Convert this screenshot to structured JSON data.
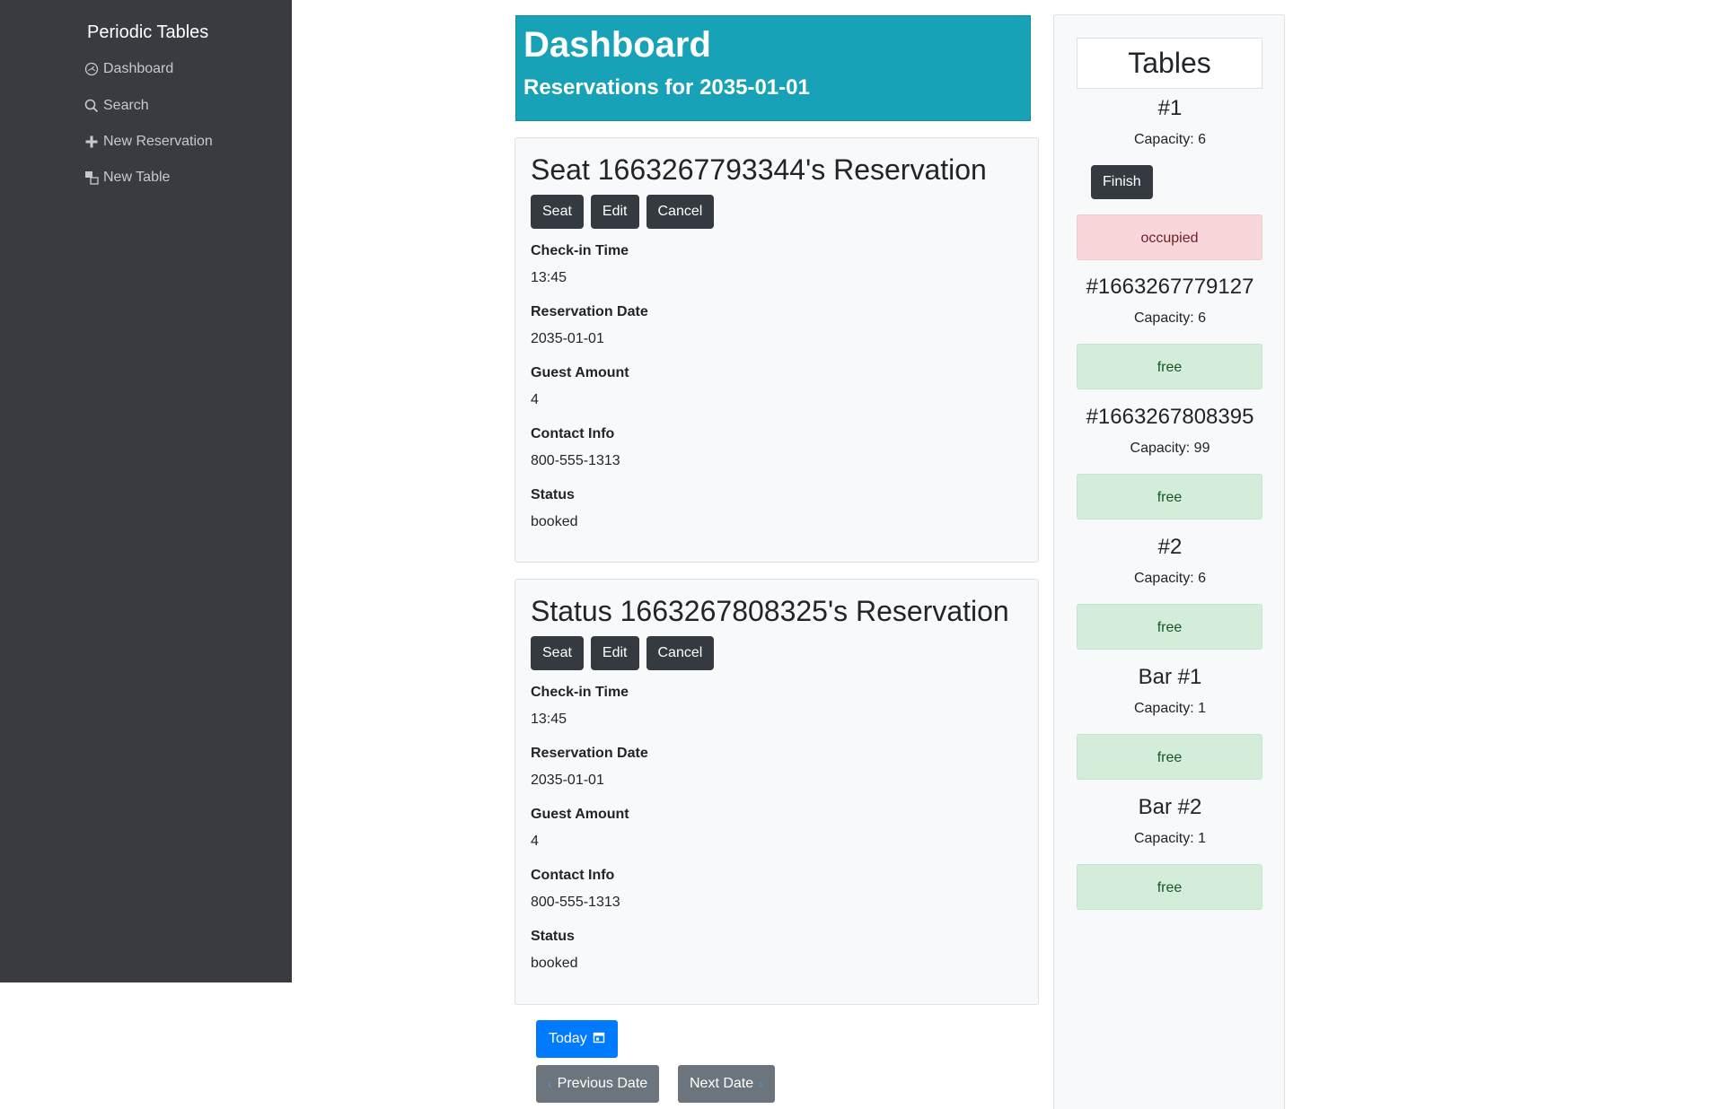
{
  "sidebar": {
    "brand": "Periodic Tables",
    "items": [
      {
        "label": "Dashboard",
        "icon": "dashboard-icon"
      },
      {
        "label": "Search",
        "icon": "search-icon"
      },
      {
        "label": "New Reservation",
        "icon": "plus-icon"
      },
      {
        "label": "New Table",
        "icon": "table-icon"
      }
    ]
  },
  "header": {
    "title": "Dashboard",
    "subtitle": "Reservations for 2035-01-01"
  },
  "reservations": [
    {
      "title": "Seat 1663267793344's Reservation",
      "seat_label": "Seat",
      "edit_label": "Edit",
      "cancel_label": "Cancel",
      "fields": [
        {
          "label": "Check-in Time",
          "value": "13:45"
        },
        {
          "label": "Reservation Date",
          "value": "2035-01-01"
        },
        {
          "label": "Guest Amount",
          "value": "4"
        },
        {
          "label": "Contact Info",
          "value": "800-555-1313"
        },
        {
          "label": "Status",
          "value": "booked"
        }
      ]
    },
    {
      "title": "Status 1663267808325's Reservation",
      "seat_label": "Seat",
      "edit_label": "Edit",
      "cancel_label": "Cancel",
      "fields": [
        {
          "label": "Check-in Time",
          "value": "13:45"
        },
        {
          "label": "Reservation Date",
          "value": "2035-01-01"
        },
        {
          "label": "Guest Amount",
          "value": "4"
        },
        {
          "label": "Contact Info",
          "value": "800-555-1313"
        },
        {
          "label": "Status",
          "value": "booked"
        }
      ]
    }
  ],
  "date_nav": {
    "today_label": "Today",
    "previous_label": "Previous Date",
    "next_label": "Next Date"
  },
  "tables": {
    "heading": "Tables",
    "finish_label": "Finish",
    "items": [
      {
        "name": "#1",
        "capacity": "Capacity: 6",
        "status": "occupied"
      },
      {
        "name": "#1663267779127",
        "capacity": "Capacity: 6",
        "status": "free"
      },
      {
        "name": "#1663267808395",
        "capacity": "Capacity: 99",
        "status": "free"
      },
      {
        "name": "#2",
        "capacity": "Capacity: 6",
        "status": "free"
      },
      {
        "name": "Bar #1",
        "capacity": "Capacity: 1",
        "status": "free"
      },
      {
        "name": "Bar #2",
        "capacity": "Capacity: 1",
        "status": "free"
      }
    ]
  },
  "colors": {
    "sidebar_bg": "#3a3b41",
    "header_bg": "#17a2b8",
    "primary": "#007bff",
    "secondary": "#6c757d",
    "dark": "#343a40",
    "free_bg": "#d4edda",
    "occupied_bg": "#f8d7da"
  }
}
